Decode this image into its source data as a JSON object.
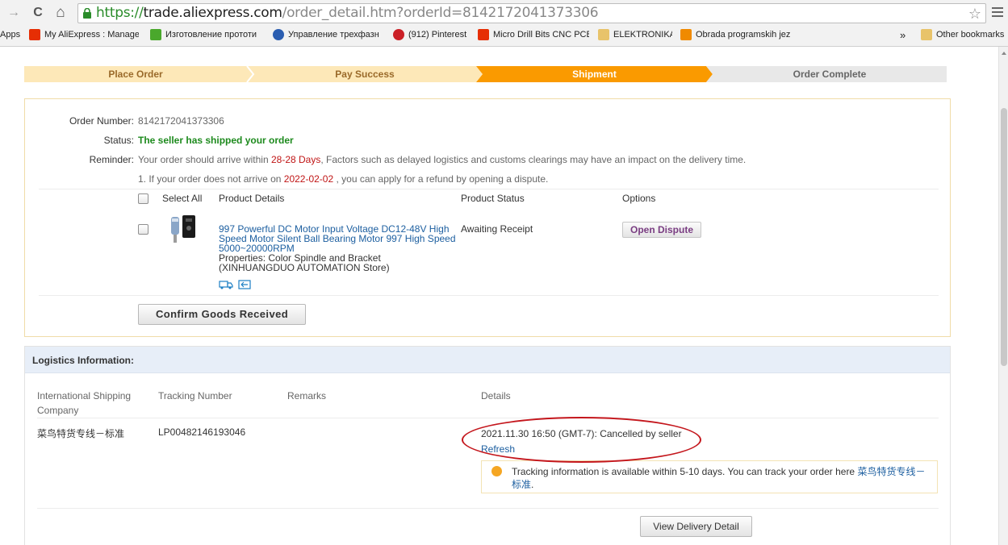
{
  "browser": {
    "url_protocol": "https://",
    "url_host": "trade.aliexpress.com",
    "url_path": "/order_detail.htm?orderId=8142172041373306",
    "star_glyph": "☆",
    "back_glyph": "→",
    "reload_glyph": "C",
    "home_glyph": "⌂",
    "bookmarks": [
      {
        "label": "Apps",
        "icon": "apps-icon"
      },
      {
        "label": "My AliExpress : Manage",
        "icon": "aliexpress-icon",
        "color": "#e62e04"
      },
      {
        "label": "Изготовление прототи",
        "icon": "puzzle-icon",
        "color": "#4aa82c"
      },
      {
        "label": "Управление трехфазн",
        "icon": "globe-icon",
        "color": "#2a5db0"
      },
      {
        "label": "(912) Pinterest",
        "icon": "pinterest-icon",
        "color": "#cb2027"
      },
      {
        "label": "Micro Drill Bits CNC PCB",
        "icon": "aliexpress-icon",
        "color": "#e62e04"
      },
      {
        "label": "ELEKTRONIKA",
        "icon": "folder-icon",
        "color": "#e8c36a"
      },
      {
        "label": "Obrada programskih jez",
        "icon": "c-icon",
        "color": "#f08a00"
      },
      {
        "label": "»",
        "icon": "chevron-icon"
      },
      {
        "label": "Other bookmarks",
        "icon": "folder-icon",
        "color": "#e8c36a"
      }
    ]
  },
  "steps": [
    {
      "label": "Place Order",
      "state": "done"
    },
    {
      "label": "Pay Success",
      "state": "done"
    },
    {
      "label": "Shipment",
      "state": "current"
    },
    {
      "label": "Order Complete",
      "state": "todo"
    }
  ],
  "order": {
    "number_label": "Order Number:",
    "number_value": "8142172041373306",
    "status_label": "Status:",
    "status_value": "The seller has shipped your order",
    "reminder_label": "Reminder:",
    "reminder_pre": "Your order should arrive within ",
    "reminder_days": "28-28 Days",
    "reminder_post": ", Factors such as delayed logistics and customs clearings may have an impact on the delivery time.",
    "note_pre": "1. If your order does not arrive on ",
    "note_date": "2022-02-02",
    "note_post": " , you can apply for a refund by opening a dispute.",
    "col_select_all": "Select All",
    "col_product": "Product Details",
    "col_status": "Product Status",
    "col_options": "Options",
    "product_title": "997 Powerful DC Motor Input Voltage DC12-48V High Speed Motor Silent Ball Bearing Motor 997 High Speed 5000~20000RPM",
    "product_properties": "Properties: Color Spindle and Bracket",
    "product_store": "(XINHUANGDUO AUTOMATION Store)",
    "product_status": "Awaiting Receipt",
    "open_dispute": "Open Dispute",
    "confirm_button": "Confirm Goods Received"
  },
  "logistics": {
    "title": "Logistics Information:",
    "col_company": "International Shipping Company",
    "col_tracking": "Tracking Number",
    "col_remarks": "Remarks",
    "col_details": "Details",
    "company": "菜鸟特货专线－标准",
    "tracking_number": "LP00482146193046",
    "event": "2021.11.30 16:50 (GMT-7): Cancelled by seller",
    "refresh": "Refresh",
    "tip_text": "Tracking information is available within 5-10 days. You can track your order here ",
    "tip_link": "菜鸟特货专线－标准",
    "tip_end": ".",
    "view_delivery": "View Delivery Detail"
  },
  "colors": {
    "step_done": "#fde8b8",
    "step_current": "#fa9a00",
    "step_todo": "#e8e8e8",
    "status_green": "#1d8a1d",
    "highlight_red": "#c01515",
    "link_blue": "#1d5fa0",
    "annotation_red": "#c4161c"
  }
}
